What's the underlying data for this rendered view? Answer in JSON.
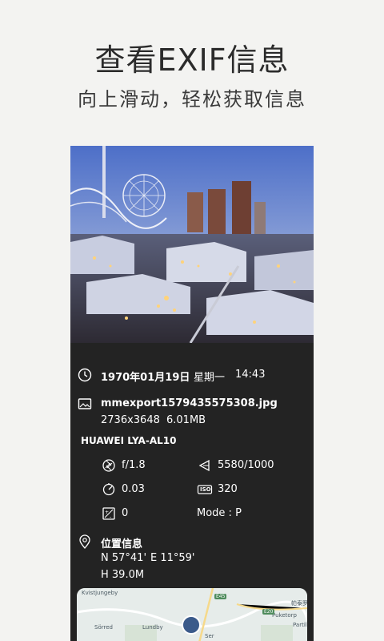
{
  "header": {
    "title": "查看EXIF信息",
    "subtitle": "向上滑动，轻松获取信息"
  },
  "photo_info": {
    "date": "1970年01月19日",
    "weekday": "星期一",
    "time": "14:43",
    "filename": "mmexport1579435575308.jpg",
    "dimensions": "2736x3648",
    "filesize": "6.01MB",
    "device": "HUAWEI LYA-AL10",
    "aperture": "f/1.8",
    "shutter": "5580/1000",
    "focal": "0.03",
    "iso_label": "ISO",
    "iso": "320",
    "exposure_bias": "0",
    "mode": "Mode : P"
  },
  "location": {
    "title": "位置信息",
    "lat": "N 57°41'",
    "lon": "E 11°59'",
    "altitude": "H 39.0M"
  },
  "map": {
    "labels": [
      "Kvistjungeby",
      "Sörred",
      "Lundby",
      "帕泰罗",
      "Puketorp",
      "Partille",
      "Ser"
    ],
    "roads": [
      "E45",
      "E20"
    ]
  },
  "colors": {
    "background": "#f3f3f1",
    "card": "#232323",
    "text_light": "#ffffff",
    "headline": "#2b2b2b"
  }
}
